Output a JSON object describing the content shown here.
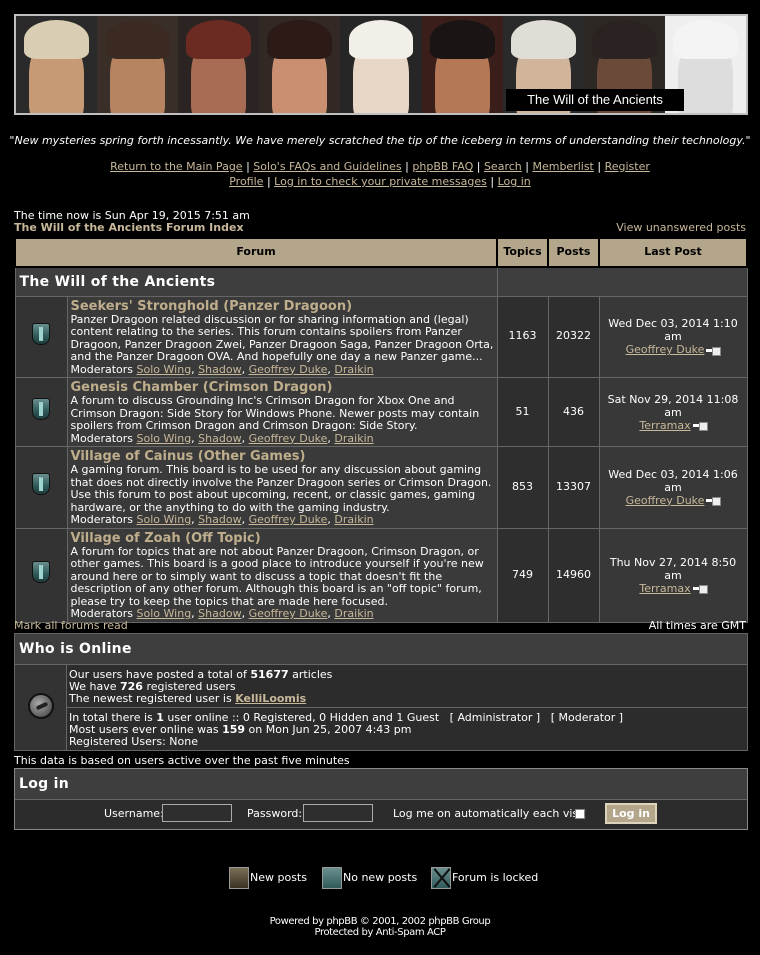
{
  "banner": {
    "title": "The Will of the Ancients",
    "portraits": [
      {
        "skin": "#c59a74",
        "hair": "#d9cdb4",
        "bg": "#2a2a2a"
      },
      {
        "skin": "#b78462",
        "hair": "#3a2a22",
        "bg": "#3a2f28"
      },
      {
        "skin": "#a86c54",
        "hair": "#6b2b23",
        "bg": "#2b2422"
      },
      {
        "skin": "#c98f70",
        "hair": "#2b1a16",
        "bg": "#322824"
      },
      {
        "skin": "#e8d6c6",
        "hair": "#f2efe9",
        "bg": "#262626"
      },
      {
        "skin": "#b47856",
        "hair": "#1a1414",
        "bg": "#3a1e1a"
      },
      {
        "skin": "#d1b49a",
        "hair": "#e0ddd6",
        "bg": "#2a2a2a"
      },
      {
        "skin": "#6b4a3a",
        "hair": "#2a2322",
        "bg": "#2e2824"
      },
      {
        "skin": "#dddddd",
        "hair": "#f4f4f4",
        "bg": "#efefef"
      }
    ]
  },
  "quote": "\"New mysteries spring forth incessantly. We have merely scratched the tip of the iceberg in terms of understanding their technology.\"",
  "nav": {
    "line1": [
      "Return to the Main Page",
      "Solo's FAQs and Guidelines",
      "phpBB FAQ",
      "Search",
      "Memberlist",
      "Register"
    ],
    "line2": [
      "Profile",
      "Log in to check your private messages",
      "Log in"
    ],
    "separator": "|"
  },
  "time_now": "The time now is Sun Apr 19, 2015 7:51 am",
  "index_link": "The Will of the Ancients Forum Index",
  "unanswered_link": "View unanswered posts",
  "table_headers": {
    "forum": "Forum",
    "topics": "Topics",
    "posts": "Posts",
    "last_post": "Last Post"
  },
  "category": "The Will of the Ancients",
  "moderators_label": "Moderators",
  "moderators": [
    "Solo Wing",
    "Shadow",
    "Geoffrey Duke",
    "Draikin"
  ],
  "forums": [
    {
      "name": "Seekers' Stronghold (Panzer Dragoon)",
      "description": "Panzer Dragoon related discussion or for sharing information and (legal) content relating to the series. This forum contains spoilers from Panzer Dragoon, Panzer Dragoon Zwei, Panzer Dragoon Saga, Panzer Dragoon Orta, and the Panzer Dragoon OVA. And hopefully one day a new Panzer game...",
      "topics": "1163",
      "posts": "20322",
      "last_date": "Wed Dec 03, 2014 1:10 am",
      "last_user": "Geoffrey Duke"
    },
    {
      "name": "Genesis Chamber (Crimson Dragon)",
      "description": "A forum to discuss Grounding Inc's Crimson Dragon for Xbox One and Crimson Dragon: Side Story for Windows Phone. Newer posts may contain spoilers from Crimson Dragon and Crimson Dragon: Side Story.",
      "topics": "51",
      "posts": "436",
      "last_date": "Sat Nov 29, 2014 11:08 am",
      "last_user": "Terramax"
    },
    {
      "name": "Village of Cainus (Other Games)",
      "description": "A gaming forum. This board is to be used for any discussion about gaming that does not directly involve the Panzer Dragoon series or Crimson Dragon. Use this forum to post about upcoming, recent, or classic games, gaming hardware, or the anything to do with the gaming industry.",
      "topics": "853",
      "posts": "13307",
      "last_date": "Wed Dec 03, 2014 1:06 am",
      "last_user": "Geoffrey Duke"
    },
    {
      "name": "Village of Zoah (Off Topic)",
      "description": "A forum for topics that are not about Panzer Dragoon, Crimson Dragon, or other games. This board is a good place to introduce yourself if you're new around here or to simply want to discuss a topic that doesn't fit the description of any other forum. Although this board is an \"off topic\" forum, please try to keep the topics that are made here focused.",
      "topics": "749",
      "posts": "14960",
      "last_date": "Thu Nov 27, 2014 8:50 am",
      "last_user": "Terramax"
    }
  ],
  "mark_read": "Mark all forums read",
  "timezone": "All times are GMT",
  "online": {
    "title": "Who is Online",
    "articles_pre": "Our users have posted a total of ",
    "articles": "51677",
    "articles_post": " articles",
    "members_pre": "We have ",
    "members": "726",
    "members_post": " registered users",
    "newest_pre": "The newest registered user is ",
    "newest": "KelliLoomis",
    "total_pre": "In total there is ",
    "total": "1",
    "total_post": " user online :: 0 Registered, 0 Hidden and 1 Guest",
    "admin": "[ Administrator ]",
    "mod": "[ Moderator ]",
    "most_pre": "Most users ever online was ",
    "most": "159",
    "most_post": " on Mon Jun 25, 2007 4:43 pm",
    "registered": "Registered Users: None"
  },
  "based_on": "This data is based on users active over the past five minutes",
  "login": {
    "title": "Log in",
    "username_label": "Username:",
    "password_label": "Password:",
    "auto_label": "Log me on automatically each visit",
    "button": "Log in"
  },
  "legend": {
    "new": "New posts",
    "nonew": "No new posts",
    "locked": "Forum is locked"
  },
  "footer": {
    "line1": "Powered by phpBB © 2001, 2002 phpBB Group",
    "line2": "Protected by Anti-Spam ACP"
  }
}
